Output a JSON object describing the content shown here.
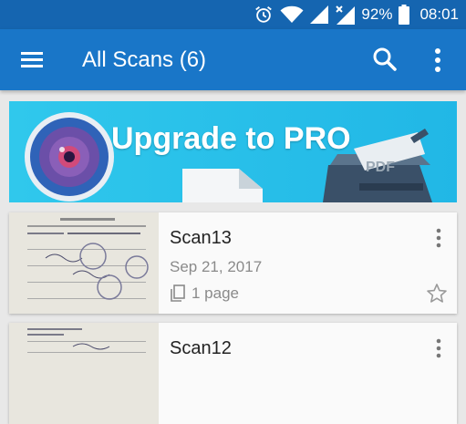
{
  "status_bar": {
    "battery_percent": "92%",
    "time": "08:01",
    "icons": [
      "alarm-icon",
      "wifi-icon",
      "signal-icon",
      "no-signal-icon",
      "battery-icon"
    ]
  },
  "toolbar": {
    "title": "All Scans (6)",
    "icons": [
      "hamburger-menu-icon",
      "search-icon",
      "more-vert-icon"
    ],
    "background_color": "#1976c8"
  },
  "banner": {
    "text": "Upgrade to PRO",
    "pdf_label": "PDF",
    "background_color": "#21b7e6"
  },
  "scans": [
    {
      "name": "Scan13",
      "date": "Sep 21, 2017",
      "pages": "1 page",
      "starred": false
    },
    {
      "name": "Scan12",
      "date": "",
      "pages": "",
      "starred": false
    }
  ]
}
